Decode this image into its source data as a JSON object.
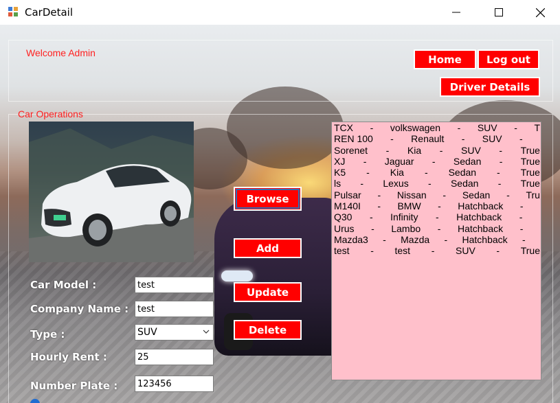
{
  "window": {
    "title": "CarDetail",
    "controls": [
      "minimize-icon",
      "maximize-icon",
      "close-icon"
    ]
  },
  "header": {
    "welcome": "Welcome Admin",
    "home_label": "Home",
    "logout_label": "Log out",
    "driver_details_label": "Driver Details"
  },
  "car_operations": {
    "group_label": "Car Operations",
    "browse_label": "Browse",
    "add_label": "Add",
    "update_label": "Update",
    "delete_label": "Delete"
  },
  "form": {
    "car_model_label": "Car Model :",
    "car_model_value": "test",
    "company_name_label": "Company Name :",
    "company_name_value": "test",
    "type_label": "Type :",
    "type_value": "SUV",
    "hourly_rent_label": "Hourly Rent :",
    "hourly_rent_value": "25",
    "number_plate_label": "Number Plate :",
    "number_plate_value": "123456"
  },
  "cars_list": [
    [
      "TCX",
      "-",
      "volkswagen",
      "-",
      "SUV",
      "-",
      "T"
    ],
    [
      "REN 100",
      "-",
      "Renault",
      "-",
      "SUV",
      "-",
      ""
    ],
    [
      "Sorenet",
      "-",
      "Kia",
      "-",
      "SUV",
      "-",
      "True"
    ],
    [
      "XJ",
      "-",
      "Jaguar",
      "-",
      "Sedan",
      "-",
      "True"
    ],
    [
      "K5",
      "-",
      "Kia",
      "-",
      "Sedan",
      "-",
      "True"
    ],
    [
      "ls",
      "-",
      "Lexus",
      "-",
      "Sedan",
      "-",
      "True"
    ],
    [
      "Pulsar",
      "-",
      "Nissan",
      "-",
      "Sedan",
      "-",
      "Tru"
    ],
    [
      "M140I",
      "-",
      "BMW",
      "-",
      "Hatchback",
      "-",
      ""
    ],
    [
      "Q30",
      "-",
      "Infinity",
      "-",
      "Hatchback",
      "-",
      ""
    ],
    [
      "Urus",
      "-",
      "Lambo",
      "-",
      "Hatchback",
      "-",
      ""
    ],
    [
      "Mazda3",
      "-",
      "Mazda",
      "-",
      "Hatchback",
      "-",
      ""
    ],
    [
      "test",
      "-",
      "test",
      "-",
      "SUV",
      "-",
      "True"
    ]
  ],
  "colors": {
    "accent_red": "#ff0000",
    "list_background": "#ffc0cb",
    "label_red": "#ff2020"
  }
}
